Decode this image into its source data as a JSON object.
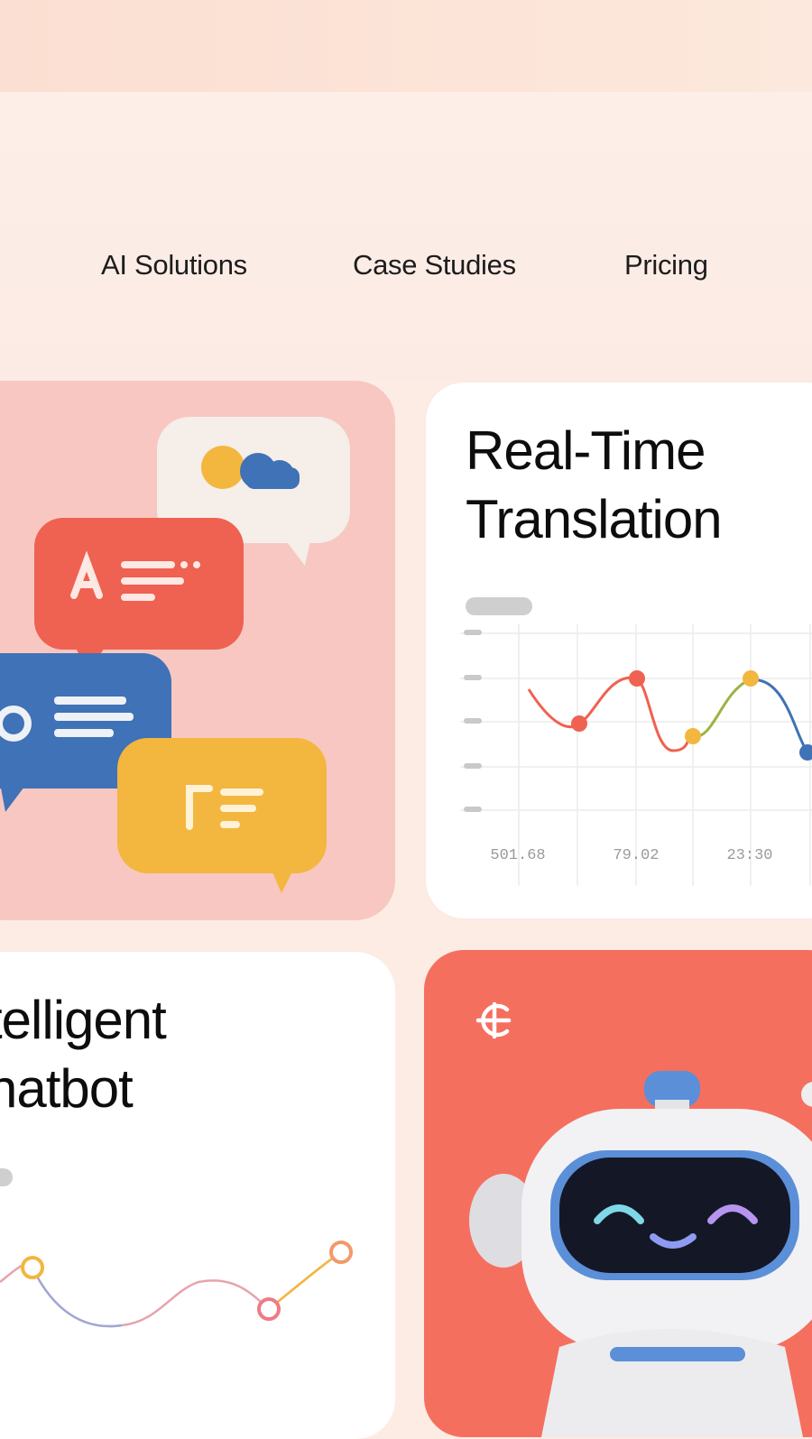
{
  "nav": {
    "items": [
      {
        "label": "AI Solutions"
      },
      {
        "label": "Case Studies"
      },
      {
        "label": "Pricing"
      }
    ]
  },
  "cards": {
    "translation": {
      "title_line1": "Real-Time",
      "title_line2": "Translation",
      "x_ticks": [
        "501.68",
        "79.02",
        "23:30"
      ]
    },
    "chatbot": {
      "title_line1": "telligent",
      "title_line2": "hatbot"
    }
  },
  "icons": {
    "chat_bubbles": "chat-bubbles-illustration",
    "robot": "robot-illustration",
    "robot_logo": "currency-like-logo-icon"
  },
  "colors": {
    "page_bg": "#fcece4",
    "chat_card": "#f8c7c2",
    "robot_card": "#f56f5f",
    "accent_red": "#ef6150",
    "accent_blue": "#3f72b6",
    "accent_yellow": "#f3b63f"
  }
}
